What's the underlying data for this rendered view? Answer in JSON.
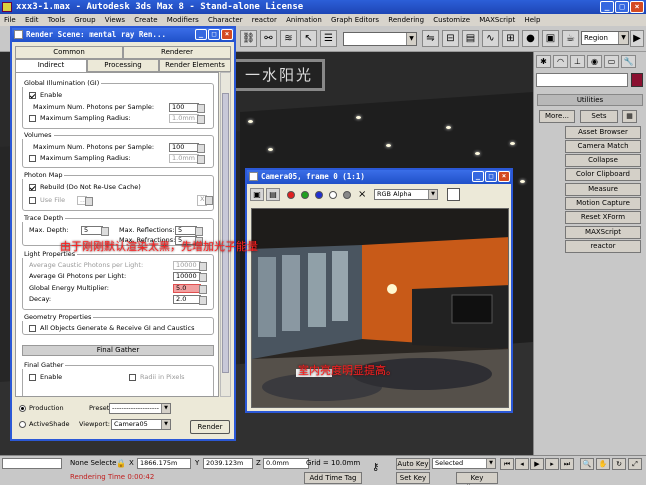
{
  "app": {
    "title": "xxx3-1.max - Autodesk 3ds Max 8 - Stand-alone License",
    "window_buttons": [
      "_",
      "□",
      "×"
    ]
  },
  "menu": [
    "File",
    "Edit",
    "Tools",
    "Group",
    "Views",
    "Create",
    "Modifiers",
    "Character",
    "reactor",
    "Animation",
    "Graph Editors",
    "Rendering",
    "Customize",
    "MAXScript",
    "Help"
  ],
  "toolbar": {
    "region_select": "Region"
  },
  "viewport": {
    "logo_text": "一水阳光"
  },
  "command_panel": {
    "utilities_header": "Utilities",
    "more_label": "More...",
    "sets_label": "Sets",
    "buttons": [
      "Asset Browser",
      "Camera Match",
      "Collapse",
      "Color Clipboard",
      "Measure",
      "Motion Capture",
      "Reset XForm",
      "MAXScript",
      "reactor"
    ],
    "object_color": "#8a1030"
  },
  "render_scene": {
    "title": "Render Scene: mental ray Ren...",
    "tabs_top": [
      "Common",
      "Renderer"
    ],
    "tabs_bottom": [
      "Indirect Illumination",
      "Processing",
      "Render Elements"
    ],
    "global_illumination": {
      "title": "Global Illumination (GI)",
      "enable_label": "Enable",
      "max_photons_label": "Maximum Num. Photons per Sample:",
      "max_photons_value": "100",
      "max_radius_label": "Maximum Sampling Radius:",
      "max_radius_value": "1.0mm"
    },
    "volumes": {
      "title": "Volumes",
      "max_photons_label": "Maximum Num. Photons per Sample:",
      "max_photons_value": "100",
      "max_radius_label": "Maximum Sampling Radius:",
      "max_radius_value": "1.0mm"
    },
    "photon_map": {
      "title": "Photon Map",
      "rebuild_label": "Rebuild (Do Not Re-Use Cache)",
      "use_file_label": "Use File",
      "browse_label": "...",
      "clear_label": "X"
    },
    "trace_depth": {
      "title": "Trace Depth",
      "max_depth_label": "Max. Depth:",
      "max_depth_value": "5",
      "max_reflections_label": "Max. Reflections:",
      "max_reflections_value": "5",
      "max_refractions_label": "Max. Refractions:",
      "max_refractions_value": "5"
    },
    "light_properties": {
      "title": "Light Properties",
      "avg_caustic_label": "Average Caustic Photons per Light:",
      "avg_caustic_value": "10000",
      "avg_gi_label": "Average GI Photons per Light:",
      "avg_gi_value": "10000",
      "global_energy_label": "Global Energy Multiplier:",
      "global_energy_value": "5.0",
      "decay_label": "Decay:",
      "decay_value": "2.0"
    },
    "geometry_properties": {
      "title": "Geometry Properties",
      "all_objects_label": "All Objects Generate & Receive GI and Caustics"
    },
    "final_gather": {
      "header": "Final Gather",
      "group_title": "Final Gather",
      "enable_label": "Enable",
      "radii_label": "Radii in Pixels"
    },
    "bottom": {
      "production_label": "Production",
      "activeshade_label": "ActiveShade",
      "preset_label": "Preset:",
      "preset_value": "--------------------",
      "viewport_label": "Viewport:",
      "viewport_value": "Camera05",
      "render_label": "Render"
    }
  },
  "frame_window": {
    "title": "Camera05, frame 0 (1:1)",
    "channel_select": "RGB Alpha",
    "clear_label": "×"
  },
  "annotations": {
    "top_note": "由于刚刚默认渲染太黑，先增加光子能量",
    "bottom_note": "室内亮度明显提高。"
  },
  "statusbar": {
    "status_field": "",
    "render_time": "Rendering Time  0:00:42",
    "selection": "None Selecte",
    "x_label": "X",
    "x_value": "1866.175m",
    "y_label": "Y",
    "y_value": "2039.123m",
    "z_label": "Z",
    "z_value": "0.0mm",
    "grid": "Grid = 10.0mm",
    "add_time_tag": "Add Time Tag",
    "auto_key": "Auto Key",
    "set_key": "Set Key",
    "key_mode": "Selected",
    "key_filters": "Key Filters..."
  }
}
